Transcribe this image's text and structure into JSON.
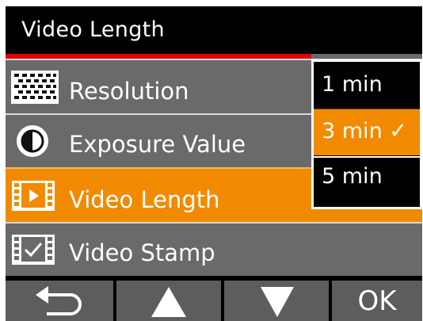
{
  "header": {
    "title": "Video Length"
  },
  "menu": {
    "items": [
      {
        "label": "Resolution",
        "icon": "resolution-icon",
        "selected": false
      },
      {
        "label": "Exposure Value",
        "icon": "exposure-icon",
        "selected": false
      },
      {
        "label": "Video Length",
        "icon": "film-icon",
        "selected": true
      },
      {
        "label": "Video Stamp",
        "icon": "stamp-icon",
        "selected": false
      }
    ]
  },
  "popup": {
    "options": [
      {
        "label": "1 min",
        "selected": false
      },
      {
        "label": "3 min ✓",
        "selected": true
      },
      {
        "label": "5 min",
        "selected": false
      }
    ]
  },
  "nav": {
    "back_icon": "back-arrow-icon",
    "up_icon": "up-triangle-icon",
    "down_icon": "down-triangle-icon",
    "ok_label": "OK"
  },
  "colors": {
    "accent": "#f28a00",
    "menu_bg": "#6a6a6a",
    "title_bg": "#000000",
    "title_rule": "#e00000"
  }
}
